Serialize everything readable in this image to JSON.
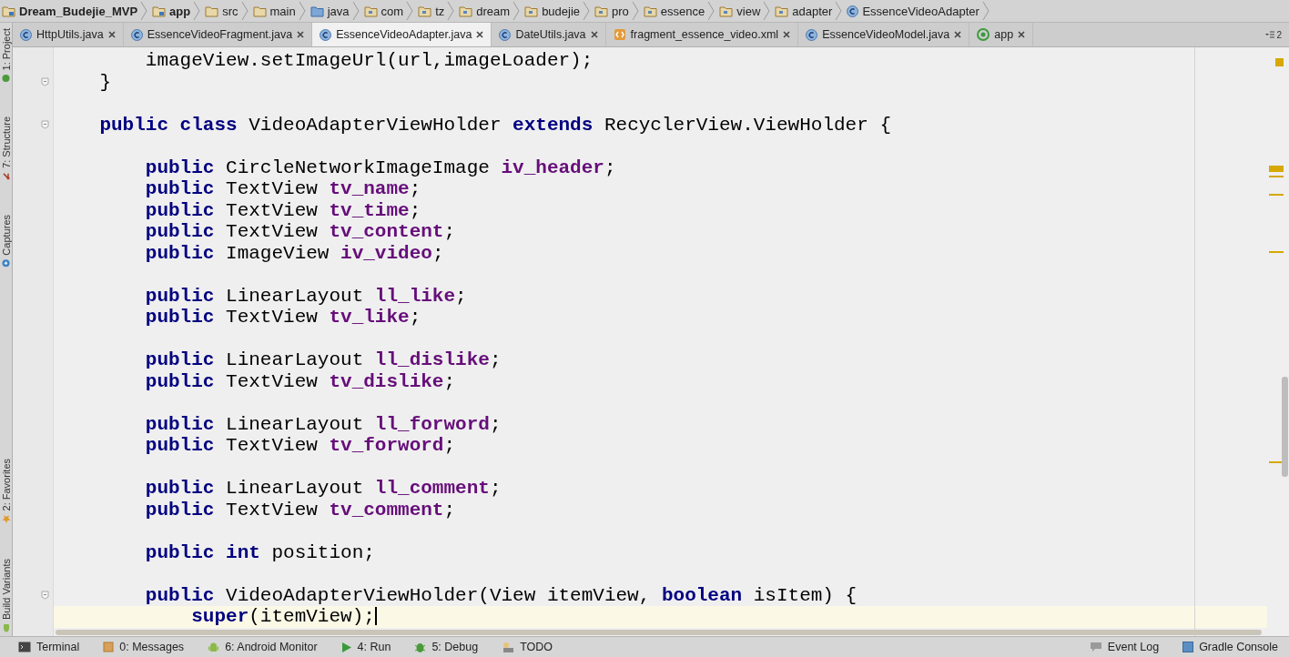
{
  "breadcrumbs": [
    {
      "label": "Dream_Budejie_MVP",
      "kind": "module"
    },
    {
      "label": "app",
      "kind": "module"
    },
    {
      "label": "src",
      "kind": "folder"
    },
    {
      "label": "main",
      "kind": "folder"
    },
    {
      "label": "java",
      "kind": "source"
    },
    {
      "label": "com",
      "kind": "package"
    },
    {
      "label": "tz",
      "kind": "package"
    },
    {
      "label": "dream",
      "kind": "package"
    },
    {
      "label": "budejie",
      "kind": "package"
    },
    {
      "label": "pro",
      "kind": "package"
    },
    {
      "label": "essence",
      "kind": "package"
    },
    {
      "label": "view",
      "kind": "package"
    },
    {
      "label": "adapter",
      "kind": "package"
    },
    {
      "label": "EssenceVideoAdapter",
      "kind": "class"
    }
  ],
  "tool_strip_top": [
    {
      "label": "1: Project",
      "kind": "project"
    },
    {
      "label": "7: Structure",
      "kind": "structure"
    },
    {
      "label": "Captures",
      "kind": "captures"
    }
  ],
  "tool_strip_bottom": [
    {
      "label": "2: Favorites",
      "kind": "favorites"
    },
    {
      "label": "Build Variants",
      "kind": "android"
    }
  ],
  "tabs": [
    {
      "label": "HttpUtils.java",
      "kind": "class",
      "selected": false
    },
    {
      "label": "EssenceVideoFragment.java",
      "kind": "class",
      "selected": false
    },
    {
      "label": "EssenceVideoAdapter.java",
      "kind": "class",
      "selected": true
    },
    {
      "label": "DateUtils.java",
      "kind": "class",
      "selected": false
    },
    {
      "label": "fragment_essence_video.xml",
      "kind": "xml",
      "selected": false
    },
    {
      "label": "EssenceVideoModel.java",
      "kind": "class",
      "selected": false
    },
    {
      "label": "app",
      "kind": "run",
      "selected": false
    }
  ],
  "tab_overflow": "2",
  "code_lines": [
    {
      "kind": "code",
      "current": false,
      "fold": false,
      "tokens": [
        {
          "text": "        imageView.setImageUrl(url,imageLoader);",
          "kind": "plain"
        }
      ]
    },
    {
      "kind": "code",
      "current": false,
      "fold": true,
      "tokens": [
        {
          "text": "    }",
          "kind": "plain"
        }
      ]
    },
    {
      "kind": "blank"
    },
    {
      "kind": "code",
      "current": false,
      "fold": true,
      "tokens": [
        {
          "text": "    public class ",
          "kind": "keyword"
        },
        {
          "text": "VideoAdapterViewHolder ",
          "kind": "plain"
        },
        {
          "text": "extends ",
          "kind": "keyword"
        },
        {
          "text": "RecyclerView.ViewHolder {",
          "kind": "plain"
        }
      ]
    },
    {
      "kind": "blank"
    },
    {
      "kind": "code",
      "current": false,
      "fold": false,
      "tokens": [
        {
          "text": "        public ",
          "kind": "keyword"
        },
        {
          "text": "CircleNetworkImageImage ",
          "kind": "plain"
        },
        {
          "text": "iv_header",
          "kind": "field"
        },
        {
          "text": ";",
          "kind": "plain"
        }
      ]
    },
    {
      "kind": "code",
      "current": false,
      "fold": false,
      "tokens": [
        {
          "text": "        public ",
          "kind": "keyword"
        },
        {
          "text": "TextView ",
          "kind": "plain"
        },
        {
          "text": "tv_name",
          "kind": "field"
        },
        {
          "text": ";",
          "kind": "plain"
        }
      ]
    },
    {
      "kind": "code",
      "current": false,
      "fold": false,
      "tokens": [
        {
          "text": "        public ",
          "kind": "keyword"
        },
        {
          "text": "TextView ",
          "kind": "plain"
        },
        {
          "text": "tv_time",
          "kind": "field"
        },
        {
          "text": ";",
          "kind": "plain"
        }
      ]
    },
    {
      "kind": "code",
      "current": false,
      "fold": false,
      "tokens": [
        {
          "text": "        public ",
          "kind": "keyword"
        },
        {
          "text": "TextView ",
          "kind": "plain"
        },
        {
          "text": "tv_content",
          "kind": "field"
        },
        {
          "text": ";",
          "kind": "plain"
        }
      ]
    },
    {
      "kind": "code",
      "current": false,
      "fold": false,
      "tokens": [
        {
          "text": "        public ",
          "kind": "keyword"
        },
        {
          "text": "ImageView ",
          "kind": "plain"
        },
        {
          "text": "iv_video",
          "kind": "field"
        },
        {
          "text": ";",
          "kind": "plain"
        }
      ]
    },
    {
      "kind": "blank"
    },
    {
      "kind": "code",
      "current": false,
      "fold": false,
      "tokens": [
        {
          "text": "        public ",
          "kind": "keyword"
        },
        {
          "text": "LinearLayout ",
          "kind": "plain"
        },
        {
          "text": "ll_like",
          "kind": "field"
        },
        {
          "text": ";",
          "kind": "plain"
        }
      ]
    },
    {
      "kind": "code",
      "current": false,
      "fold": false,
      "tokens": [
        {
          "text": "        public ",
          "kind": "keyword"
        },
        {
          "text": "TextView ",
          "kind": "plain"
        },
        {
          "text": "tv_like",
          "kind": "field"
        },
        {
          "text": ";",
          "kind": "plain"
        }
      ]
    },
    {
      "kind": "blank"
    },
    {
      "kind": "code",
      "current": false,
      "fold": false,
      "tokens": [
        {
          "text": "        public ",
          "kind": "keyword"
        },
        {
          "text": "LinearLayout ",
          "kind": "plain"
        },
        {
          "text": "ll_dislike",
          "kind": "field"
        },
        {
          "text": ";",
          "kind": "plain"
        }
      ]
    },
    {
      "kind": "code",
      "current": false,
      "fold": false,
      "tokens": [
        {
          "text": "        public ",
          "kind": "keyword"
        },
        {
          "text": "TextView ",
          "kind": "plain"
        },
        {
          "text": "tv_dislike",
          "kind": "field"
        },
        {
          "text": ";",
          "kind": "plain"
        }
      ]
    },
    {
      "kind": "blank"
    },
    {
      "kind": "code",
      "current": false,
      "fold": false,
      "tokens": [
        {
          "text": "        public ",
          "kind": "keyword"
        },
        {
          "text": "LinearLayout ",
          "kind": "plain"
        },
        {
          "text": "ll_forword",
          "kind": "field"
        },
        {
          "text": ";",
          "kind": "plain"
        }
      ]
    },
    {
      "kind": "code",
      "current": false,
      "fold": false,
      "tokens": [
        {
          "text": "        public ",
          "kind": "keyword"
        },
        {
          "text": "TextView ",
          "kind": "plain"
        },
        {
          "text": "tv_forword",
          "kind": "field"
        },
        {
          "text": ";",
          "kind": "plain"
        }
      ]
    },
    {
      "kind": "blank"
    },
    {
      "kind": "code",
      "current": false,
      "fold": false,
      "tokens": [
        {
          "text": "        public ",
          "kind": "keyword"
        },
        {
          "text": "LinearLayout ",
          "kind": "plain"
        },
        {
          "text": "ll_comment",
          "kind": "field"
        },
        {
          "text": ";",
          "kind": "plain"
        }
      ]
    },
    {
      "kind": "code",
      "current": false,
      "fold": false,
      "tokens": [
        {
          "text": "        public ",
          "kind": "keyword"
        },
        {
          "text": "TextView ",
          "kind": "plain"
        },
        {
          "text": "tv_comment",
          "kind": "field"
        },
        {
          "text": ";",
          "kind": "plain"
        }
      ]
    },
    {
      "kind": "blank"
    },
    {
      "kind": "code",
      "current": false,
      "fold": false,
      "tokens": [
        {
          "text": "        public int ",
          "kind": "keyword"
        },
        {
          "text": "position;",
          "kind": "plain"
        }
      ]
    },
    {
      "kind": "blank"
    },
    {
      "kind": "code",
      "current": false,
      "fold": true,
      "tokens": [
        {
          "text": "        public ",
          "kind": "keyword"
        },
        {
          "text": "VideoAdapterViewHolder(View itemView, ",
          "kind": "plain"
        },
        {
          "text": "boolean ",
          "kind": "keyword"
        },
        {
          "text": "isItem) {",
          "kind": "plain"
        }
      ]
    },
    {
      "kind": "code",
      "current": true,
      "fold": false,
      "tokens": [
        {
          "text": "            super",
          "kind": "keyword"
        },
        {
          "text": "(itemView);",
          "kind": "plain"
        }
      ]
    }
  ],
  "status_bar_left": [
    {
      "label": "Terminal",
      "kind": "terminal"
    },
    {
      "label": "0: Messages",
      "kind": "messages"
    },
    {
      "label": "6: Android Monitor",
      "kind": "android"
    },
    {
      "label": "4: Run",
      "kind": "run"
    },
    {
      "label": "5: Debug",
      "kind": "debug"
    },
    {
      "label": "TODO",
      "kind": "todo"
    }
  ],
  "status_bar_right": [
    {
      "label": "Event Log",
      "kind": "event-log"
    },
    {
      "label": "Gradle Console",
      "kind": "gradle"
    }
  ]
}
